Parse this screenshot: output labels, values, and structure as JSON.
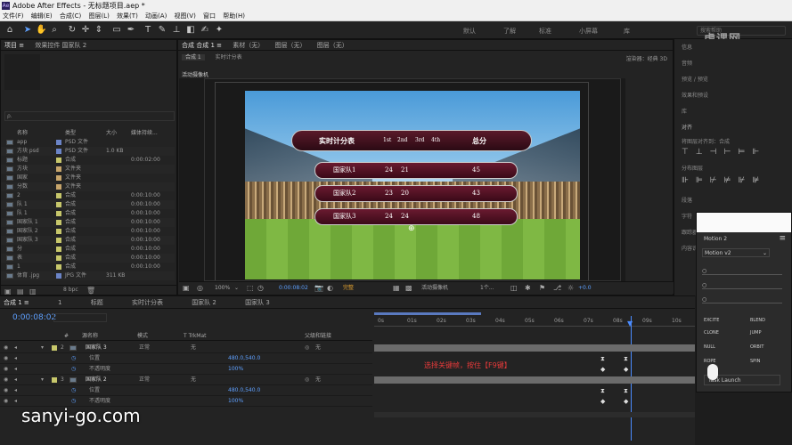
{
  "window": {
    "title": "Adobe After Effects - 无标题项目.aep *",
    "app_icon": "Ae"
  },
  "menu": [
    "文件(F)",
    "编辑(E)",
    "合成(C)",
    "图层(L)",
    "效果(T)",
    "动画(A)",
    "视图(V)",
    "窗口",
    "帮助(H)"
  ],
  "toolbar": {
    "workspaces": [
      "默认",
      "了解",
      "标准",
      "小屏幕",
      "库"
    ],
    "search_placeholder": "搜索帮助",
    "watermark_logo": "虎课网"
  },
  "project_panel": {
    "tabs": [
      "项目 ≡",
      "效果控件 国家队 2"
    ],
    "search_placeholder": "ρ.",
    "columns": [
      "名称",
      "类型",
      "大小",
      "媒体持续..."
    ],
    "items": [
      {
        "name": "app",
        "type": "PSD 文件",
        "size": "",
        "duration": "",
        "color": "#6b84c7"
      },
      {
        "name": "方块 psd",
        "type": "PSD 文件",
        "size": "1.0 KB",
        "duration": "",
        "color": "#6b84c7"
      },
      {
        "name": "标题",
        "type": "合成",
        "size": "",
        "duration": "0:00:02:00",
        "color": "#c7c76b"
      },
      {
        "name": "方块",
        "type": "文件夹",
        "size": "",
        "duration": "",
        "color": "#c7a56b"
      },
      {
        "name": "国家",
        "type": "文件夹",
        "size": "",
        "duration": "",
        "color": "#c7a56b"
      },
      {
        "name": "分数",
        "type": "文件夹",
        "size": "",
        "duration": "",
        "color": "#c7a56b"
      },
      {
        "name": "2",
        "type": "合成",
        "size": "",
        "duration": "0:00:10:00",
        "color": "#c7c76b"
      },
      {
        "name": "队 1",
        "type": "合成",
        "size": "",
        "duration": "0:00:10:00",
        "color": "#c7c76b"
      },
      {
        "name": "队 1",
        "type": "合成",
        "size": "",
        "duration": "0:00:10:00",
        "color": "#c7c76b"
      },
      {
        "name": "国家队 1",
        "type": "合成",
        "size": "",
        "duration": "0:00:10:00",
        "color": "#c7c76b"
      },
      {
        "name": "国家队 2",
        "type": "合成",
        "size": "",
        "duration": "0:00:10:00",
        "color": "#c7c76b"
      },
      {
        "name": "国家队 3",
        "type": "合成",
        "size": "",
        "duration": "0:00:10:00",
        "color": "#c7c76b"
      },
      {
        "name": "分",
        "type": "合成",
        "size": "",
        "duration": "0:00:10:00",
        "color": "#c7c76b"
      },
      {
        "name": "表",
        "type": "合成",
        "size": "",
        "duration": "0:00:10:00",
        "color": "#c7c76b"
      },
      {
        "name": "1",
        "type": "合成",
        "size": "",
        "duration": "0:00:10:00",
        "color": "#c7c76b"
      },
      {
        "name": "体育 .jpg",
        "type": "JPG 文件",
        "size": "311 KB",
        "duration": "",
        "color": "#6b84c7"
      }
    ],
    "footer_bpc": "8 bpc"
  },
  "composition_panel": {
    "tabs": [
      "合成 合成 1 ≡",
      "素材（无）",
      "图层（无）",
      "图层（无）"
    ],
    "breadcrumb": [
      "合成 1",
      "实时计分表"
    ],
    "renderer": "渲染器：经典 3D",
    "camera_label": "活动摄像机",
    "scoreboard": {
      "header_title": "实时计分表",
      "header_cols": [
        "1st",
        "2nd",
        "3rd",
        "4th"
      ],
      "header_total": "总分",
      "rows": [
        {
          "team": "国家队1",
          "s1": "24",
          "s2": "21",
          "total": "45"
        },
        {
          "team": "国家队2",
          "s1": "23",
          "s2": "20",
          "total": "43"
        },
        {
          "team": "国家队3",
          "s1": "24",
          "s2": "24",
          "total": "48"
        }
      ]
    },
    "controls": {
      "zoom": "100%",
      "timecode": "0:00:08:02",
      "resolution": "完整",
      "view": "活动摄像机",
      "views": "1个...",
      "exposure": "+0.0"
    }
  },
  "right_panel": {
    "items": [
      "信息",
      "音频",
      "预览 / 预览",
      "效果和预设",
      "库",
      "对齐",
      "将图层对齐到：合成",
      "分布图层",
      "段落",
      "字符",
      "跟踪器",
      "内容识别填充"
    ],
    "align_to_value": "合成"
  },
  "motion_panel": {
    "title": "Motion 2",
    "dropdown": "Motion v2",
    "buttons": [
      "EXCITE",
      "BLEND",
      "CLONE",
      "JUMP",
      "NULL",
      "ORBIT",
      "ROPE",
      "SPIN"
    ],
    "bottom_button": "Task Launch"
  },
  "timeline": {
    "tabs": [
      "合成 1 ≡",
      "1",
      "标题",
      "实时计分表",
      "国家队 2",
      "国家队 3"
    ],
    "timecode": "0:00:08:02",
    "columns": [
      "#",
      "源名称",
      "模式",
      "T TrkMat",
      "父级和链接"
    ],
    "layers": [
      {
        "num": "2",
        "name": "国家队 3",
        "mode": "正常",
        "trkmat": "无",
        "parent": "无",
        "value": "",
        "indent": 0
      },
      {
        "num": "",
        "name": "位置",
        "mode": "",
        "trkmat": "",
        "parent": "",
        "value": "480.0,540.0",
        "indent": 1
      },
      {
        "num": "",
        "name": "不透明度",
        "mode": "",
        "trkmat": "",
        "parent": "",
        "value": "100%",
        "indent": 1
      },
      {
        "num": "3",
        "name": "国家队 2",
        "mode": "正常",
        "trkmat": "无",
        "parent": "无",
        "value": "",
        "indent": 0
      },
      {
        "num": "",
        "name": "位置",
        "mode": "",
        "trkmat": "",
        "parent": "",
        "value": "480.0,540.0",
        "indent": 1
      },
      {
        "num": "",
        "name": "不透明度",
        "mode": "",
        "trkmat": "",
        "parent": "",
        "value": "100%",
        "indent": 1
      }
    ],
    "ruler_ticks": [
      "0s",
      "01s",
      "02s",
      "03s",
      "04s",
      "05s",
      "06s",
      "07s",
      "08s",
      "09s",
      "10s"
    ],
    "annotation": "选择关键帧，按住【F9键】"
  },
  "bottom_watermark": "sanyi-go.com"
}
